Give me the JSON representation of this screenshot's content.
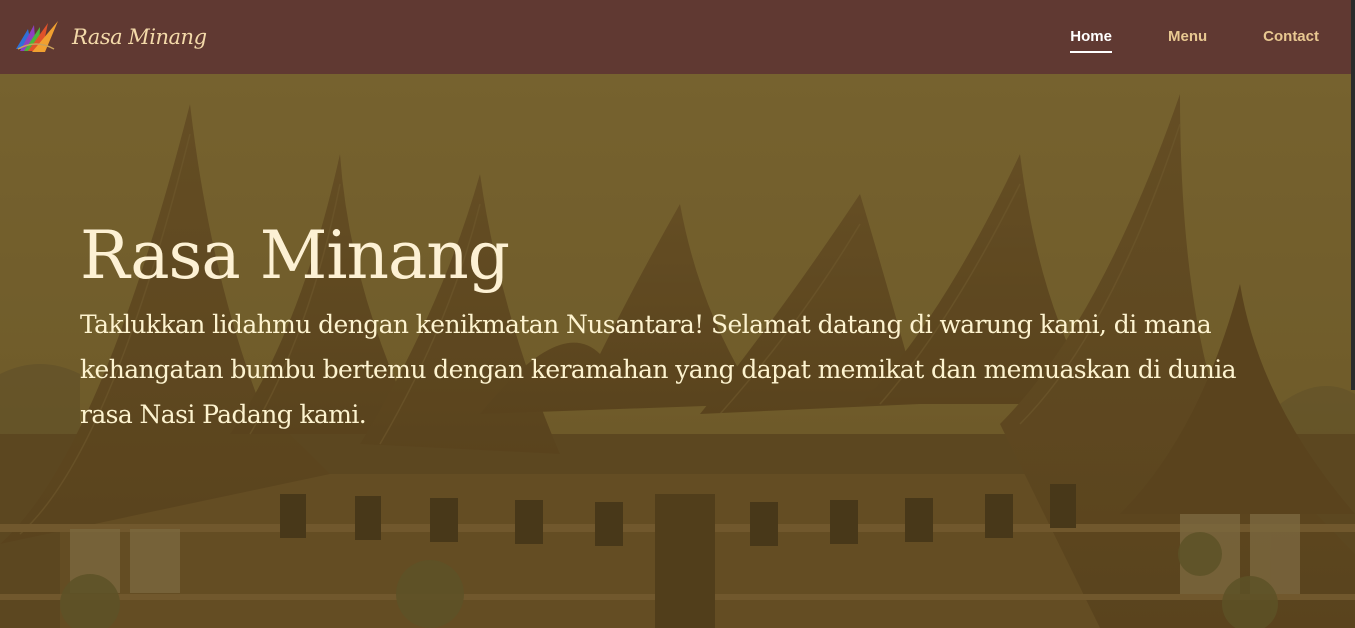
{
  "brand": {
    "name": "Rasa Minang",
    "logo_icon": "fan-logo-icon"
  },
  "nav": {
    "items": [
      {
        "label": "Home",
        "active": true
      },
      {
        "label": "Menu",
        "active": false
      },
      {
        "label": "Contact",
        "active": false
      }
    ]
  },
  "hero": {
    "title": "Rasa Minang",
    "text": "Taklukkan lidahmu dengan kenikmatan Nusantara! Selamat datang di warung kami, di mana kehangatan bumbu bertemu dengan keramahan yang dapat memikat dan memuaskan di dunia rasa Nasi Padang kami.",
    "background": "rumah-gadang-photo"
  },
  "colors": {
    "navbar": "#603932",
    "brand_text": "#f3d9a9",
    "nav_active": "#ffffff",
    "nav_inactive": "#e8c891",
    "hero_text": "#fdf3cf"
  }
}
